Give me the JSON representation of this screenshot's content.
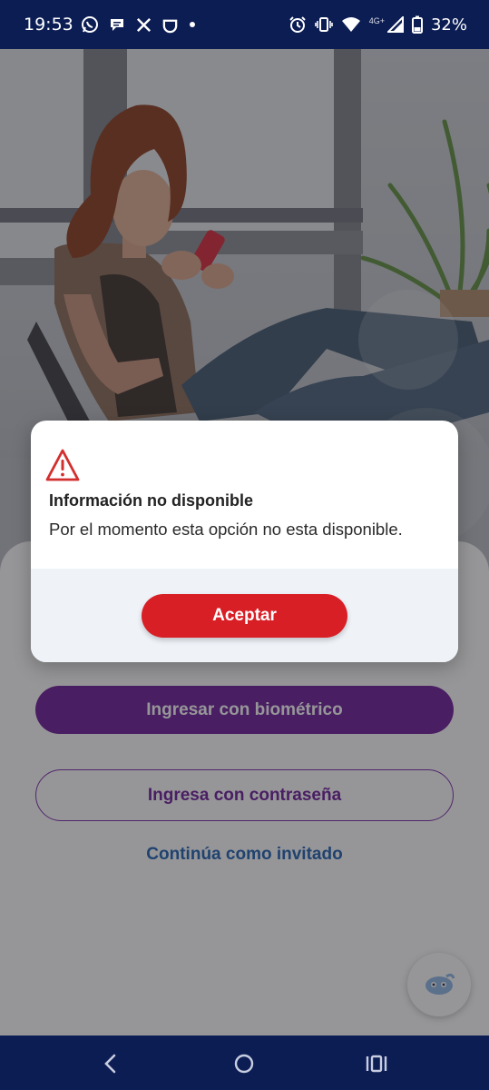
{
  "status_bar": {
    "time": "19:53",
    "network": "4G+",
    "battery_percent": "32%",
    "icons_left": [
      "whatsapp-icon",
      "chat-icon",
      "x-icon",
      "didi-icon",
      "dot-icon"
    ],
    "icons_right": [
      "alarm-icon",
      "vibrate-icon",
      "wifi-icon",
      "signal-icon",
      "battery-icon"
    ]
  },
  "login": {
    "biometric_label": "Ingresar con biométrico",
    "password_label": "Ingresa con contraseña",
    "guest_label": "Continúa como invitado"
  },
  "dialog": {
    "title": "Información no disponible",
    "message": "Por el momento esta opción no esta disponible.",
    "accept_label": "Aceptar"
  },
  "colors": {
    "status_bar": "#0c1d54",
    "primary_purple": "#6c1a9a",
    "accept_red": "#d91f26",
    "link_blue": "#1d5fb0",
    "warning_red": "#d32f2f"
  }
}
